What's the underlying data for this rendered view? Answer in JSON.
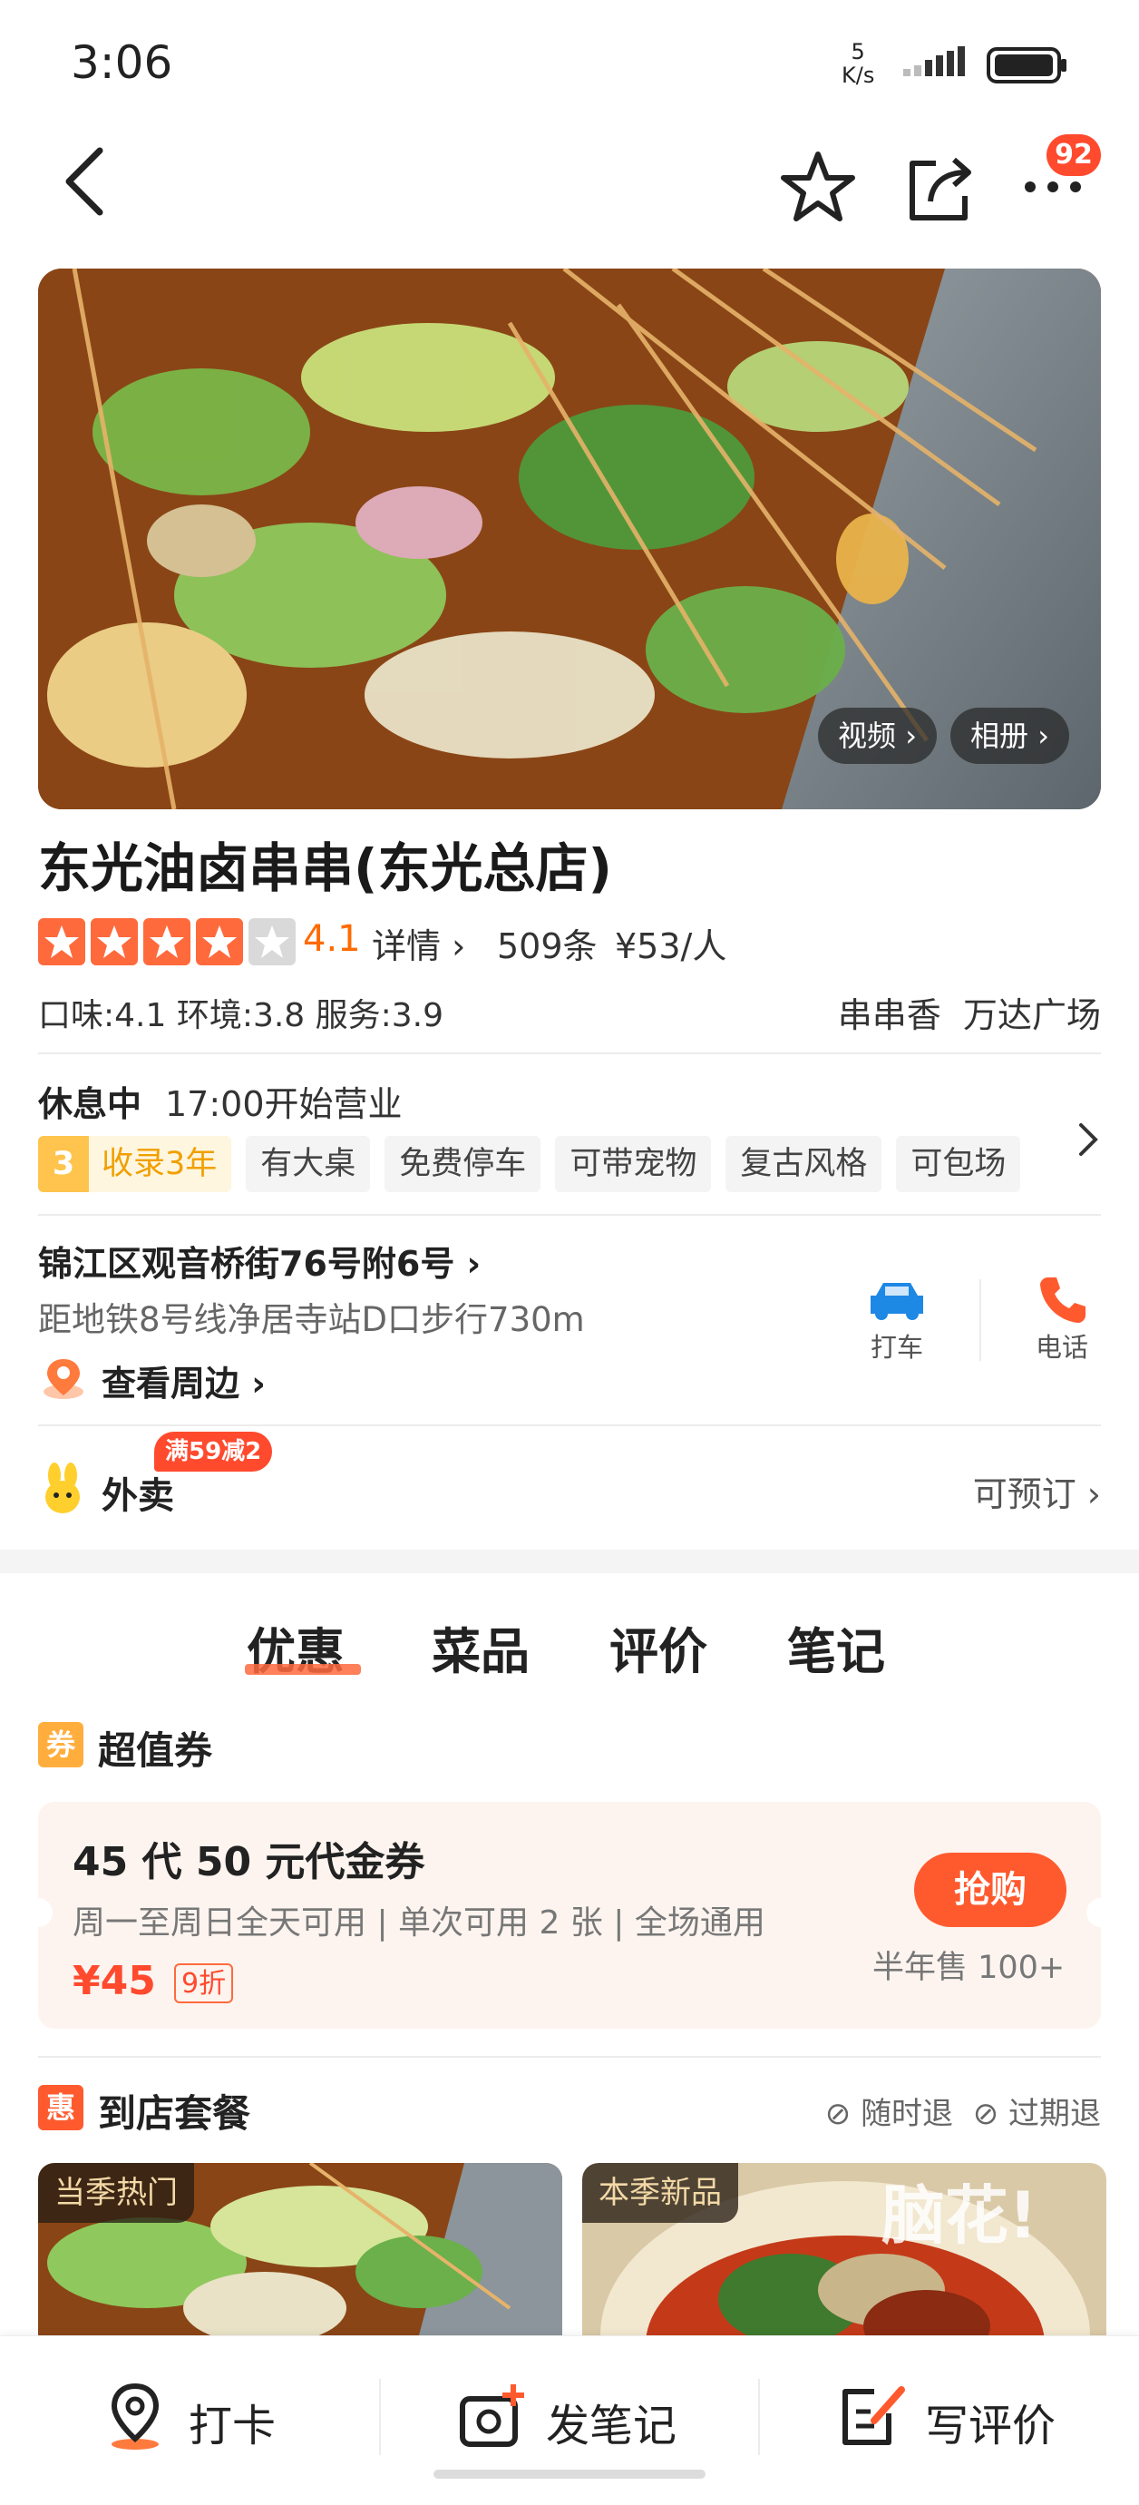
{
  "status_bar": {
    "time": "3:06",
    "net_speed_value": "5",
    "net_speed_unit": "K/s"
  },
  "header": {
    "more_badge": "92"
  },
  "hero": {
    "video_label": "视频",
    "album_label": "相册"
  },
  "shop": {
    "name": "东光油卤串串(东光总店)",
    "rating_value": 4.1,
    "rating": "4.1",
    "detail_label": "详情",
    "review_count": "509条",
    "per_person_price": "¥53/人",
    "scores": "口味:4.1  环境:3.8  服务:3.9",
    "category": "串串香",
    "district": "万达广场"
  },
  "business": {
    "status": "休息中",
    "open_time": "17:00开始营业",
    "years_num": "3",
    "years_label": "收录3年",
    "features": [
      "有大桌",
      "免费停车",
      "可带宠物",
      "复古风格",
      "可包场"
    ]
  },
  "location": {
    "address": "锦江区观音桥街76号附6号",
    "metro": "距地铁8号线净居寺站D口步行730m",
    "nearby": "查看周边",
    "taxi_label": "打车",
    "phone_label": "电话"
  },
  "delivery": {
    "label": "外卖",
    "badge": "满59减2",
    "reservable": "可预订"
  },
  "tabs": [
    "优惠",
    "菜品",
    "评价",
    "笔记"
  ],
  "coupon_section": {
    "icon_text": "券",
    "title": "超值券",
    "name": "45 代 50 元代金券",
    "desc": "周一至周日全天可用 | 单次可用 2 张 | 全场通用",
    "price": "¥45",
    "discount": "9折",
    "buy_label": "抢购",
    "sold": "半年售 100+"
  },
  "package_section": {
    "icon_text": "惠",
    "title": "到店套餐",
    "refund_anytime": "随时退",
    "refund_expired": "过期退",
    "cards": [
      {
        "tag": "当季热门"
      },
      {
        "tag": "本季新品",
        "overlay_text": "脑花!"
      }
    ]
  },
  "bottom_nav": {
    "checkin": "打卡",
    "post_note": "发笔记",
    "write_review": "写评价"
  },
  "colors": {
    "accent": "#ff6a00",
    "badge_red": "#ff4a2e",
    "star": "#ff6a3d",
    "taxi_blue": "#1e88e5"
  }
}
